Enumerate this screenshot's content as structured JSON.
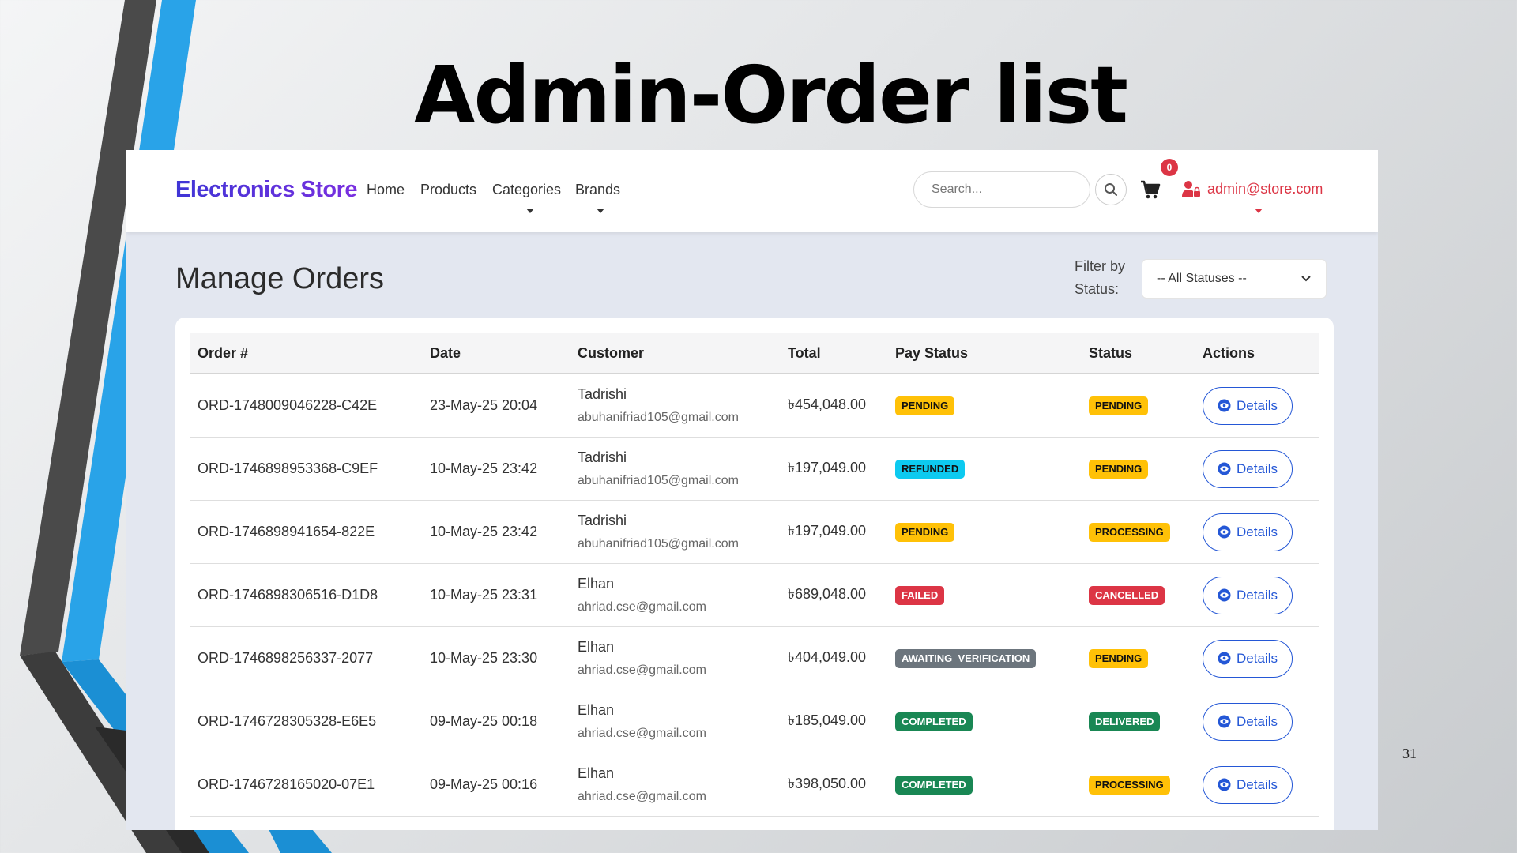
{
  "slide": {
    "title": "Admin-Order list",
    "page_number": "31"
  },
  "navbar": {
    "brand": "Electronics Store",
    "links": [
      {
        "label": "Home",
        "dropdown": false
      },
      {
        "label": "Products",
        "dropdown": false
      },
      {
        "label": "Categories",
        "dropdown": true
      },
      {
        "label": "Brands",
        "dropdown": true
      }
    ],
    "search_placeholder": "Search...",
    "cart_count": "0",
    "user_email": "admin@store.com"
  },
  "page": {
    "title": "Manage Orders",
    "filter_label": "Filter by Status:",
    "filter_value": "-- All Statuses --"
  },
  "table": {
    "columns": [
      "Order #",
      "Date",
      "Customer",
      "Total",
      "Pay Status",
      "Status",
      "Actions"
    ],
    "details_label": "Details",
    "rows": [
      {
        "order": "ORD-1748009046228-C42E",
        "date": "23-May-25 20:04",
        "name": "Tadrishi",
        "email": "abuhanifriad105@gmail.com",
        "total": "৳454,048.00",
        "pay_status": "PENDING",
        "status": "PENDING"
      },
      {
        "order": "ORD-1746898953368-C9EF",
        "date": "10-May-25 23:42",
        "name": "Tadrishi",
        "email": "abuhanifriad105@gmail.com",
        "total": "৳197,049.00",
        "pay_status": "REFUNDED",
        "status": "PENDING"
      },
      {
        "order": "ORD-1746898941654-822E",
        "date": "10-May-25 23:42",
        "name": "Tadrishi",
        "email": "abuhanifriad105@gmail.com",
        "total": "৳197,049.00",
        "pay_status": "PENDING",
        "status": "PROCESSING"
      },
      {
        "order": "ORD-1746898306516-D1D8",
        "date": "10-May-25 23:31",
        "name": "Elhan",
        "email": "ahriad.cse@gmail.com",
        "total": "৳689,048.00",
        "pay_status": "FAILED",
        "status": "CANCELLED"
      },
      {
        "order": "ORD-1746898256337-2077",
        "date": "10-May-25 23:30",
        "name": "Elhan",
        "email": "ahriad.cse@gmail.com",
        "total": "৳404,049.00",
        "pay_status": "AWAITING_VERIFICATION",
        "status": "PENDING"
      },
      {
        "order": "ORD-1746728305328-E6E5",
        "date": "09-May-25 00:18",
        "name": "Elhan",
        "email": "ahriad.cse@gmail.com",
        "total": "৳185,049.00",
        "pay_status": "COMPLETED",
        "status": "DELIVERED"
      },
      {
        "order": "ORD-1746728165020-07E1",
        "date": "09-May-25 00:16",
        "name": "Elhan",
        "email": "ahriad.cse@gmail.com",
        "total": "৳398,050.00",
        "pay_status": "COMPLETED",
        "status": "PROCESSING"
      }
    ]
  },
  "status_colors": {
    "PENDING": "#ffc107",
    "PROCESSING": "#ffc107",
    "REFUNDED": "#0dcaf0",
    "FAILED": "#dc3545",
    "CANCELLED": "#dc3545",
    "AWAITING_VERIFICATION": "#6c757d",
    "COMPLETED": "#198754",
    "DELIVERED": "#198754"
  },
  "icons": {
    "search": "search-icon",
    "cart": "cart-icon",
    "user": "user-lock-icon",
    "details": "eye-icon",
    "select": "chevron-down-icon"
  }
}
